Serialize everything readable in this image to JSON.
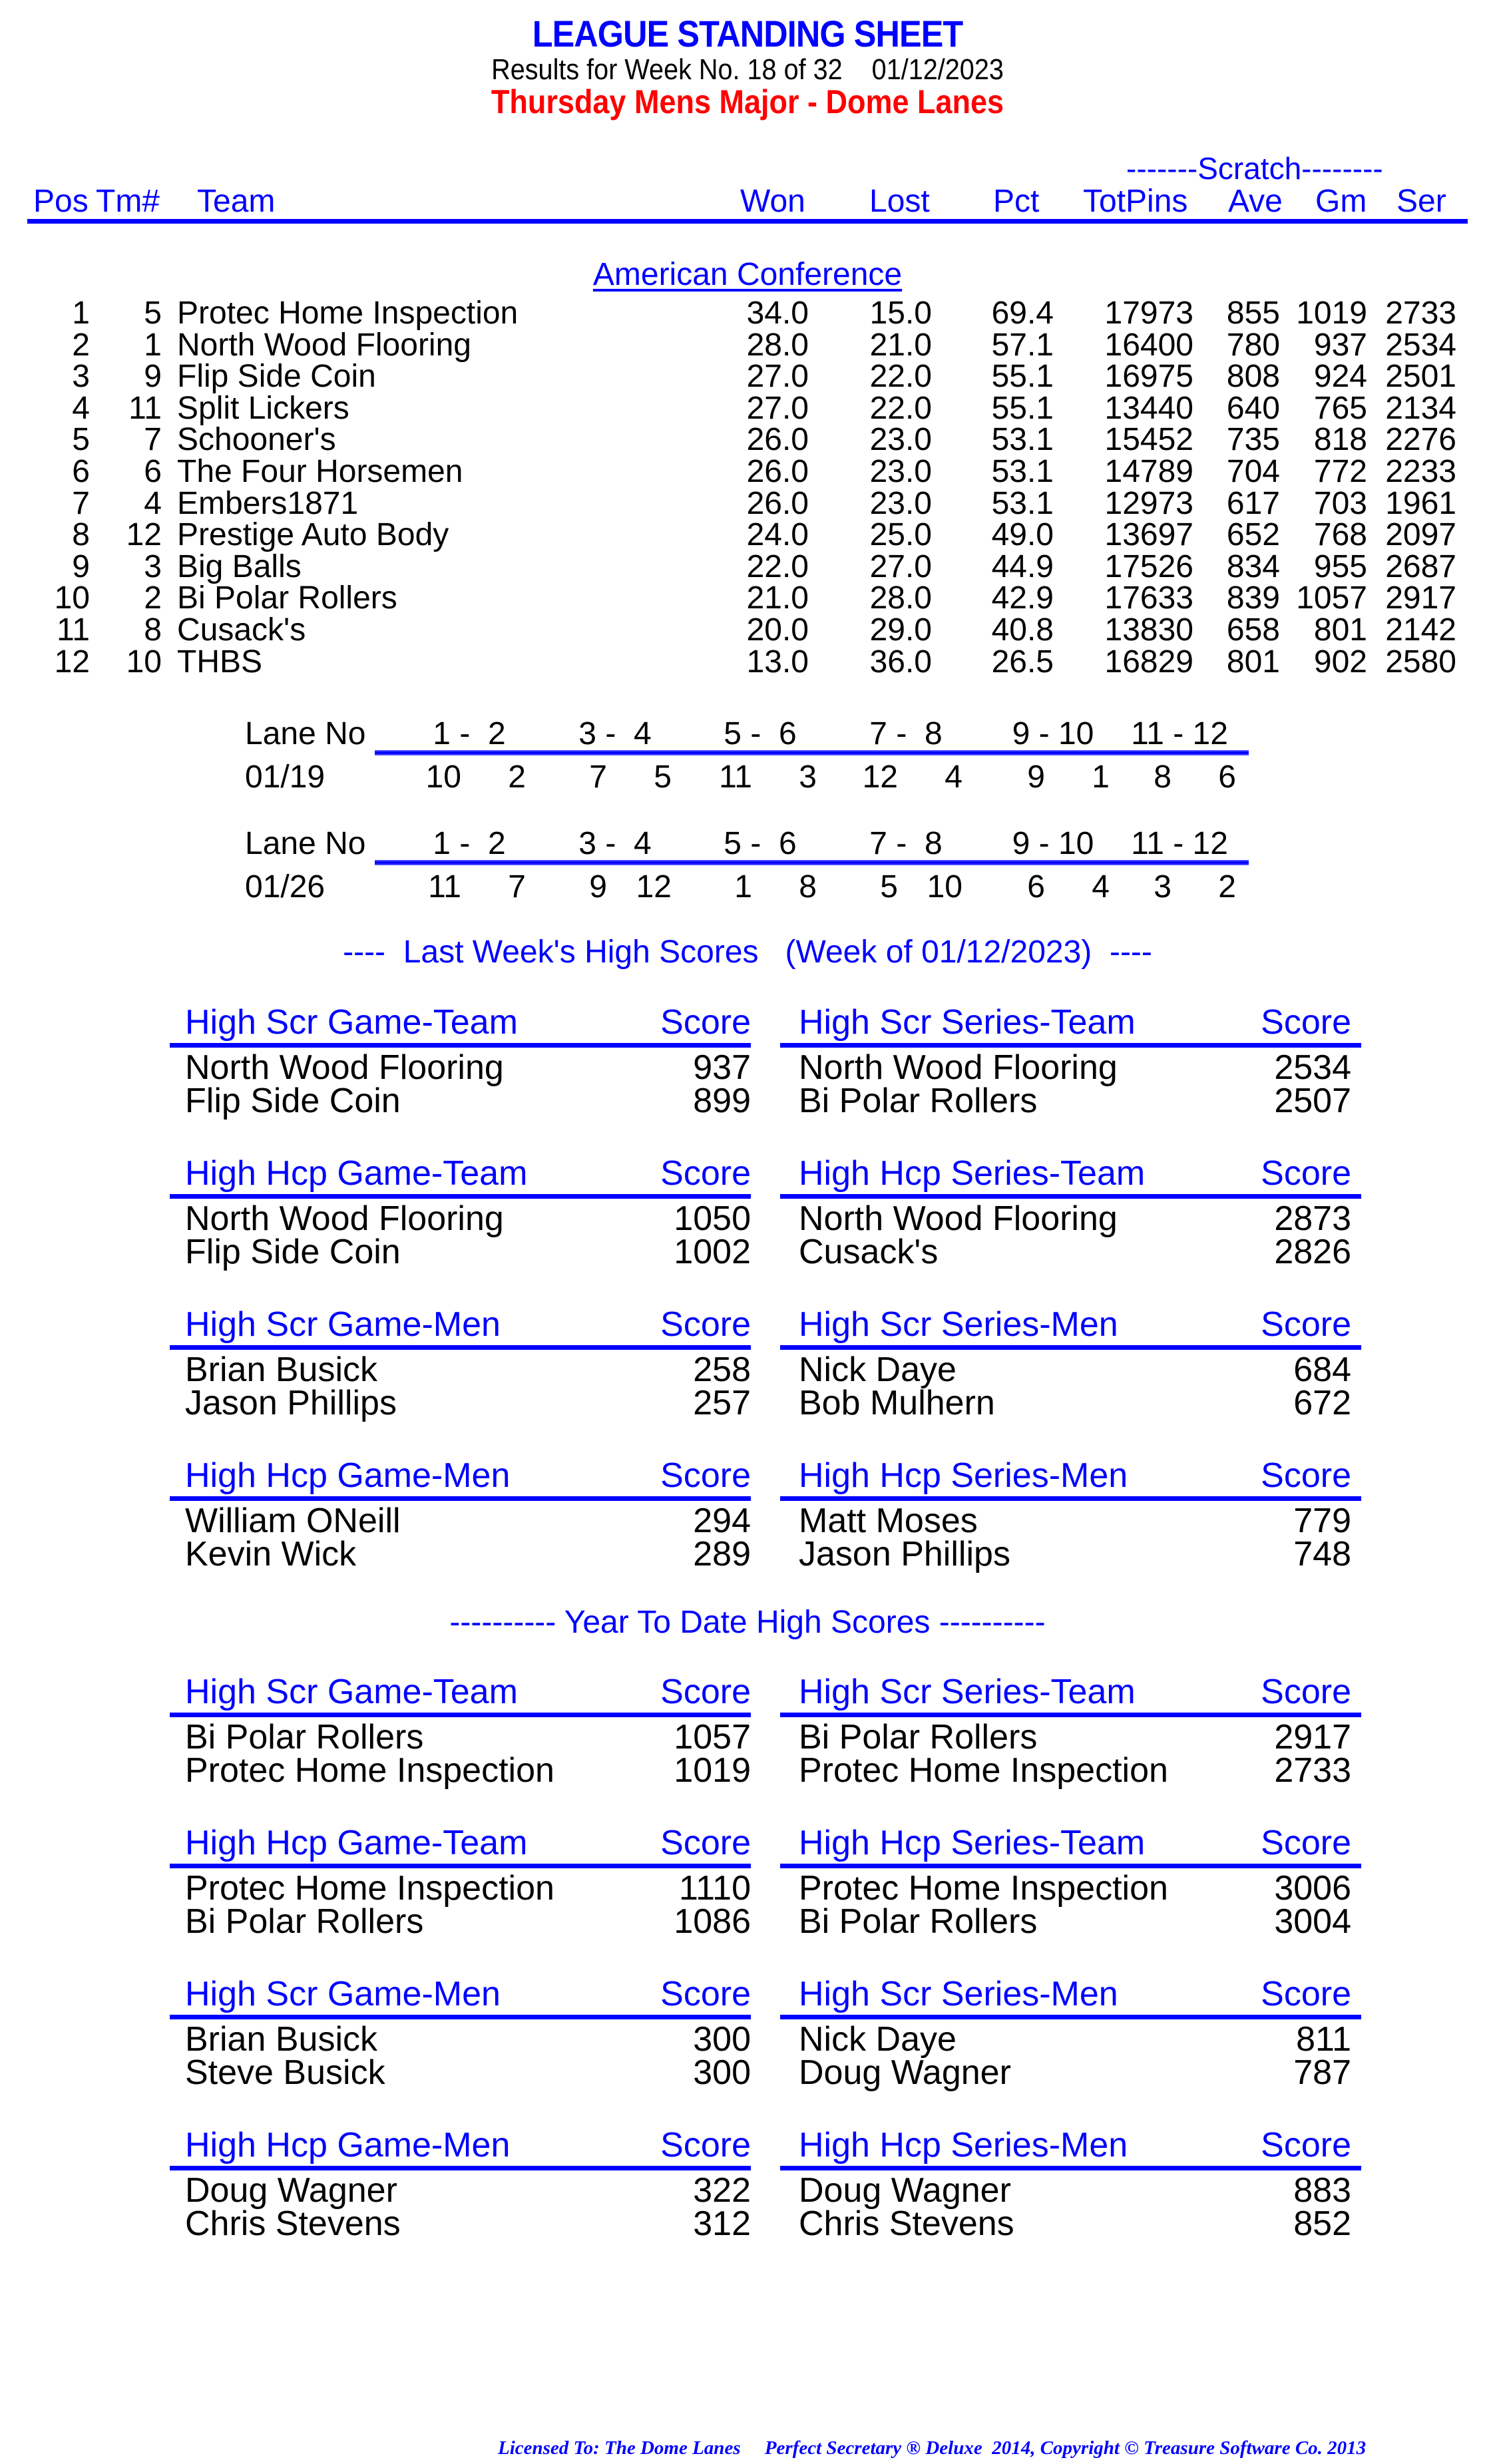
{
  "header": {
    "title": "LEAGUE STANDING SHEET",
    "subtitle": "Results for Week No. 18 of 32    01/12/2023",
    "league": "Thursday Mens Major - Dome Lanes"
  },
  "standings": {
    "scratch_label": "-------Scratch--------",
    "columns": [
      "Pos",
      "Tm#",
      "Team",
      "Won",
      "Lost",
      "Pct",
      "TotPins",
      "Ave",
      "Gm",
      "Ser"
    ],
    "conference": "American Conference",
    "rows": [
      {
        "pos": "1",
        "tm": "5",
        "team": "Protec Home Inspection",
        "won": "34.0",
        "lost": "15.0",
        "pct": "69.4",
        "totpins": "17973",
        "ave": "855",
        "gm": "1019",
        "ser": "2733"
      },
      {
        "pos": "2",
        "tm": "1",
        "team": "North Wood Flooring",
        "won": "28.0",
        "lost": "21.0",
        "pct": "57.1",
        "totpins": "16400",
        "ave": "780",
        "gm": "937",
        "ser": "2534"
      },
      {
        "pos": "3",
        "tm": "9",
        "team": "Flip Side Coin",
        "won": "27.0",
        "lost": "22.0",
        "pct": "55.1",
        "totpins": "16975",
        "ave": "808",
        "gm": "924",
        "ser": "2501"
      },
      {
        "pos": "4",
        "tm": "11",
        "team": "Split Lickers",
        "won": "27.0",
        "lost": "22.0",
        "pct": "55.1",
        "totpins": "13440",
        "ave": "640",
        "gm": "765",
        "ser": "2134"
      },
      {
        "pos": "5",
        "tm": "7",
        "team": "Schooner's",
        "won": "26.0",
        "lost": "23.0",
        "pct": "53.1",
        "totpins": "15452",
        "ave": "735",
        "gm": "818",
        "ser": "2276"
      },
      {
        "pos": "6",
        "tm": "6",
        "team": "The Four Horsemen",
        "won": "26.0",
        "lost": "23.0",
        "pct": "53.1",
        "totpins": "14789",
        "ave": "704",
        "gm": "772",
        "ser": "2233"
      },
      {
        "pos": "7",
        "tm": "4",
        "team": "Embers1871",
        "won": "26.0",
        "lost": "23.0",
        "pct": "53.1",
        "totpins": "12973",
        "ave": "617",
        "gm": "703",
        "ser": "1961"
      },
      {
        "pos": "8",
        "tm": "12",
        "team": "Prestige Auto Body",
        "won": "24.0",
        "lost": "25.0",
        "pct": "49.0",
        "totpins": "13697",
        "ave": "652",
        "gm": "768",
        "ser": "2097"
      },
      {
        "pos": "9",
        "tm": "3",
        "team": "Big Balls",
        "won": "22.0",
        "lost": "27.0",
        "pct": "44.9",
        "totpins": "17526",
        "ave": "834",
        "gm": "955",
        "ser": "2687"
      },
      {
        "pos": "10",
        "tm": "2",
        "team": "Bi Polar Rollers",
        "won": "21.0",
        "lost": "28.0",
        "pct": "42.9",
        "totpins": "17633",
        "ave": "839",
        "gm": "1057",
        "ser": "2917"
      },
      {
        "pos": "11",
        "tm": "8",
        "team": "Cusack's",
        "won": "20.0",
        "lost": "29.0",
        "pct": "40.8",
        "totpins": "13830",
        "ave": "658",
        "gm": "801",
        "ser": "2142"
      },
      {
        "pos": "12",
        "tm": "10",
        "team": "THBS",
        "won": "13.0",
        "lost": "36.0",
        "pct": "26.5",
        "totpins": "16829",
        "ave": "801",
        "gm": "902",
        "ser": "2580"
      }
    ]
  },
  "lane_assignments": [
    {
      "label": "Lane No",
      "lanes": [
        "1 -  2",
        "3 -  4",
        "5 -  6",
        "7 -  8",
        "9 - 10",
        "11 - 12"
      ],
      "date": "01/19",
      "pairs": [
        [
          "10",
          "2"
        ],
        [
          "7",
          "5"
        ],
        [
          "11",
          "3"
        ],
        [
          "12",
          "4"
        ],
        [
          "9",
          "1"
        ],
        [
          "8",
          "6"
        ]
      ]
    },
    {
      "label": "Lane No",
      "lanes": [
        "1 -  2",
        "3 -  4",
        "5 -  6",
        "7 -  8",
        "9 - 10",
        "11 - 12"
      ],
      "date": "01/26",
      "pairs": [
        [
          "11",
          "7"
        ],
        [
          "9",
          "12"
        ],
        [
          "1",
          "8"
        ],
        [
          "5",
          "10"
        ],
        [
          "6",
          "4"
        ],
        [
          "3",
          "2"
        ]
      ]
    }
  ],
  "last_week": {
    "title": "----  Last Week's High Scores   (Week of 01/12/2023)  ----",
    "blocks": [
      {
        "title": "High Scr Game-Team",
        "score_label": "Score",
        "entries": [
          {
            "name": "North Wood Flooring",
            "score": "937"
          },
          {
            "name": "Flip Side Coin",
            "score": "899"
          }
        ]
      },
      {
        "title": "High Scr Series-Team",
        "score_label": "Score",
        "entries": [
          {
            "name": "North Wood Flooring",
            "score": "2534"
          },
          {
            "name": "Bi Polar Rollers",
            "score": "2507"
          }
        ]
      },
      {
        "title": "High Hcp Game-Team",
        "score_label": "Score",
        "entries": [
          {
            "name": "North Wood Flooring",
            "score": "1050"
          },
          {
            "name": "Flip Side Coin",
            "score": "1002"
          }
        ]
      },
      {
        "title": "High Hcp Series-Team",
        "score_label": "Score",
        "entries": [
          {
            "name": "North Wood Flooring",
            "score": "2873"
          },
          {
            "name": "Cusack's",
            "score": "2826"
          }
        ]
      },
      {
        "title": "High Scr Game-Men",
        "score_label": "Score",
        "entries": [
          {
            "name": "Brian Busick",
            "score": "258"
          },
          {
            "name": "Jason Phillips",
            "score": "257"
          }
        ]
      },
      {
        "title": "High Scr Series-Men",
        "score_label": "Score",
        "entries": [
          {
            "name": "Nick Daye",
            "score": "684"
          },
          {
            "name": "Bob Mulhern",
            "score": "672"
          }
        ]
      },
      {
        "title": "High Hcp Game-Men",
        "score_label": "Score",
        "entries": [
          {
            "name": "William ONeill",
            "score": "294"
          },
          {
            "name": "Kevin Wick",
            "score": "289"
          }
        ]
      },
      {
        "title": "High Hcp Series-Men",
        "score_label": "Score",
        "entries": [
          {
            "name": "Matt Moses",
            "score": "779"
          },
          {
            "name": "Jason Phillips",
            "score": "748"
          }
        ]
      }
    ]
  },
  "year_to_date": {
    "title": "---------- Year To Date High Scores ----------",
    "blocks": [
      {
        "title": "High Scr Game-Team",
        "score_label": "Score",
        "entries": [
          {
            "name": "Bi Polar Rollers",
            "score": "1057"
          },
          {
            "name": "Protec Home Inspection",
            "score": "1019"
          }
        ]
      },
      {
        "title": "High Scr Series-Team",
        "score_label": "Score",
        "entries": [
          {
            "name": "Bi Polar Rollers",
            "score": "2917"
          },
          {
            "name": "Protec Home Inspection",
            "score": "2733"
          }
        ]
      },
      {
        "title": "High Hcp Game-Team",
        "score_label": "Score",
        "entries": [
          {
            "name": "Protec Home Inspection",
            "score": "1110"
          },
          {
            "name": "Bi Polar Rollers",
            "score": "1086"
          }
        ]
      },
      {
        "title": "High Hcp Series-Team",
        "score_label": "Score",
        "entries": [
          {
            "name": "Protec Home Inspection",
            "score": "3006"
          },
          {
            "name": "Bi Polar Rollers",
            "score": "3004"
          }
        ]
      },
      {
        "title": "High Scr Game-Men",
        "score_label": "Score",
        "entries": [
          {
            "name": "Brian Busick",
            "score": "300"
          },
          {
            "name": "Steve Busick",
            "score": "300"
          }
        ]
      },
      {
        "title": "High Scr Series-Men",
        "score_label": "Score",
        "entries": [
          {
            "name": "Nick Daye",
            "score": "811"
          },
          {
            "name": "Doug Wagner",
            "score": "787"
          }
        ]
      },
      {
        "title": "High Hcp Game-Men",
        "score_label": "Score",
        "entries": [
          {
            "name": "Doug Wagner",
            "score": "322"
          },
          {
            "name": "Chris Stevens",
            "score": "312"
          }
        ]
      },
      {
        "title": "High Hcp Series-Men",
        "score_label": "Score",
        "entries": [
          {
            "name": "Doug Wagner",
            "score": "883"
          },
          {
            "name": "Chris Stevens",
            "score": "852"
          }
        ]
      }
    ]
  },
  "footer": "Licensed To: The Dome Lanes     Perfect Secretary ® Deluxe  2014, Copyright © Treasure Software Co. 2013"
}
